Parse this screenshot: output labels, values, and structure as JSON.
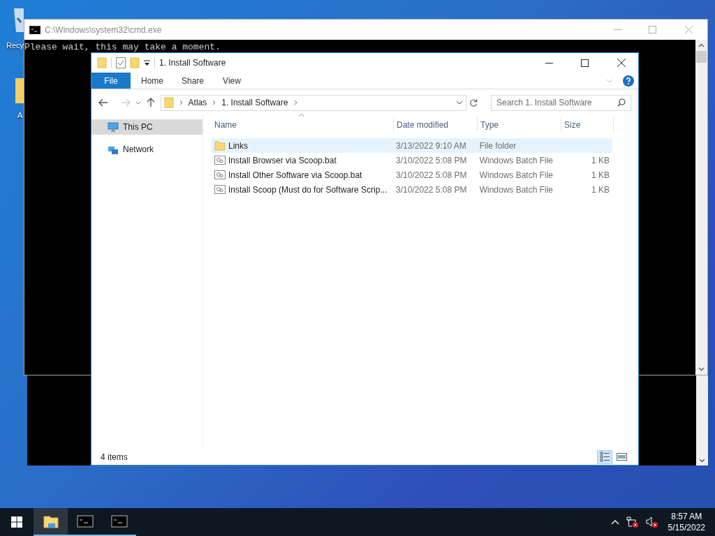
{
  "desktop_icons": [
    {
      "kind": "recycle",
      "label": "Recy"
    },
    {
      "kind": "folder",
      "label": "A"
    }
  ],
  "cmd_window": {
    "title": "C:\\Windows\\system32\\cmd.exe",
    "output": "Please wait, this may take a moment."
  },
  "explorer": {
    "title": "1. Install Software",
    "ribbon_tabs": [
      {
        "label": "File",
        "selected": true
      },
      {
        "label": "Home",
        "selected": false
      },
      {
        "label": "Share",
        "selected": false
      },
      {
        "label": "View",
        "selected": false
      }
    ],
    "breadcrumbs": [
      "Atlas",
      "1. Install Software"
    ],
    "search": {
      "placeholder": "Search 1. Install Software"
    },
    "nav": [
      {
        "kind": "pc",
        "label": "This PC",
        "selected": true
      },
      {
        "kind": "network",
        "label": "Network",
        "selected": false
      }
    ],
    "columns": [
      "Name",
      "Date modified",
      "Type",
      "Size"
    ],
    "rows": [
      {
        "kind": "folder",
        "name": "Links",
        "date": "3/13/2022 9:10 AM",
        "type": "File folder",
        "size": "",
        "highlighted": true
      },
      {
        "kind": "batch",
        "name": "Install Browser via Scoop.bat",
        "date": "3/10/2022 5:08 PM",
        "type": "Windows Batch File",
        "size": "1 KB",
        "highlighted": false
      },
      {
        "kind": "batch",
        "name": "Install Other Software via Scoop.bat",
        "date": "3/10/2022 5:08 PM",
        "type": "Windows Batch File",
        "size": "1 KB",
        "highlighted": false
      },
      {
        "kind": "batch",
        "name": "Install Scoop (Must do for Software Scrip...",
        "date": "3/10/2022 5:08 PM",
        "type": "Windows Batch File",
        "size": "1 KB",
        "highlighted": false
      }
    ],
    "status": "4 items",
    "views": [
      {
        "kind": "details",
        "selected": true
      },
      {
        "kind": "tiles",
        "selected": false
      }
    ]
  },
  "taskbar": {
    "items": [
      {
        "kind": "explorer",
        "active": true
      },
      {
        "kind": "cmd",
        "active": false
      },
      {
        "kind": "cmd",
        "active": false
      }
    ],
    "time": "8:57 AM",
    "date": "5/15/2022"
  }
}
